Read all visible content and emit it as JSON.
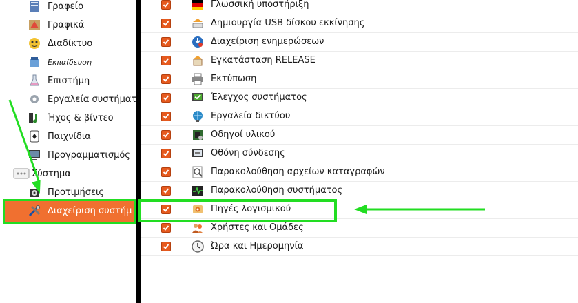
{
  "sidebar": {
    "items": [
      {
        "label": "Γραφείο",
        "icon": "office-icon"
      },
      {
        "label": "Γραφικά",
        "icon": "graphics-icon"
      },
      {
        "label": "Διαδίκτυο",
        "icon": "internet-icon"
      },
      {
        "label": "Εκπαίδευση",
        "icon": "education-icon"
      },
      {
        "label": "Επιστήμη",
        "icon": "science-icon"
      },
      {
        "label": "Εργαλεία συστήματ",
        "icon": "system-tools-icon"
      },
      {
        "label": "Ήχος & βίντεο",
        "icon": "sound-video-icon"
      },
      {
        "label": "Παιχνίδια",
        "icon": "games-icon"
      },
      {
        "label": "Προγραμματισμός",
        "icon": "programming-icon"
      },
      {
        "label": "Σύστημα",
        "icon": "system-icon"
      },
      {
        "label": "Προτιμήσεις",
        "icon": "preferences-icon"
      },
      {
        "label": "Διαχείριση συστήμ",
        "icon": "administration-icon"
      }
    ],
    "selected_index": 11
  },
  "list": {
    "rows": [
      {
        "label": "Γλωσσική υποστήριξη",
        "icon": "language-support-icon",
        "checked": true
      },
      {
        "label": "Δημιουργία USB δίσκου εκκίνησης",
        "icon": "usb-startup-disk-icon",
        "checked": true
      },
      {
        "label": "Διαχείριση ενημερώσεων",
        "icon": "update-manager-icon",
        "checked": true
      },
      {
        "label": "Εγκατάσταση RELEASE",
        "icon": "install-release-icon",
        "checked": true
      },
      {
        "label": "Εκτύπωση",
        "icon": "printer-icon",
        "checked": true
      },
      {
        "label": "Έλεγχος συστήματος",
        "icon": "system-testing-icon",
        "checked": true
      },
      {
        "label": "Εργαλεία δικτύου",
        "icon": "network-tools-icon",
        "checked": true
      },
      {
        "label": "Οδηγοί υλικού",
        "icon": "hardware-drivers-icon",
        "checked": true
      },
      {
        "label": "Οθόνη σύνδεσης",
        "icon": "login-screen-icon",
        "checked": true
      },
      {
        "label": "Παρακολούθηση αρχείων καταγραφών",
        "icon": "log-viewer-icon",
        "checked": true
      },
      {
        "label": "Παρακολούθηση συστήματος",
        "icon": "system-monitor-icon",
        "checked": true
      },
      {
        "label": "Πηγές λογισμικού",
        "icon": "software-sources-icon",
        "checked": true
      },
      {
        "label": "Χρήστες και Ομάδες",
        "icon": "users-groups-icon",
        "checked": true
      },
      {
        "label": "Ώρα και Ημερομηνία",
        "icon": "time-date-icon",
        "checked": true
      }
    ],
    "highlighted_index": 11
  },
  "colors": {
    "selection": "#f07030",
    "annotation": "#22dd22",
    "checkbox": "#e65a1e"
  }
}
